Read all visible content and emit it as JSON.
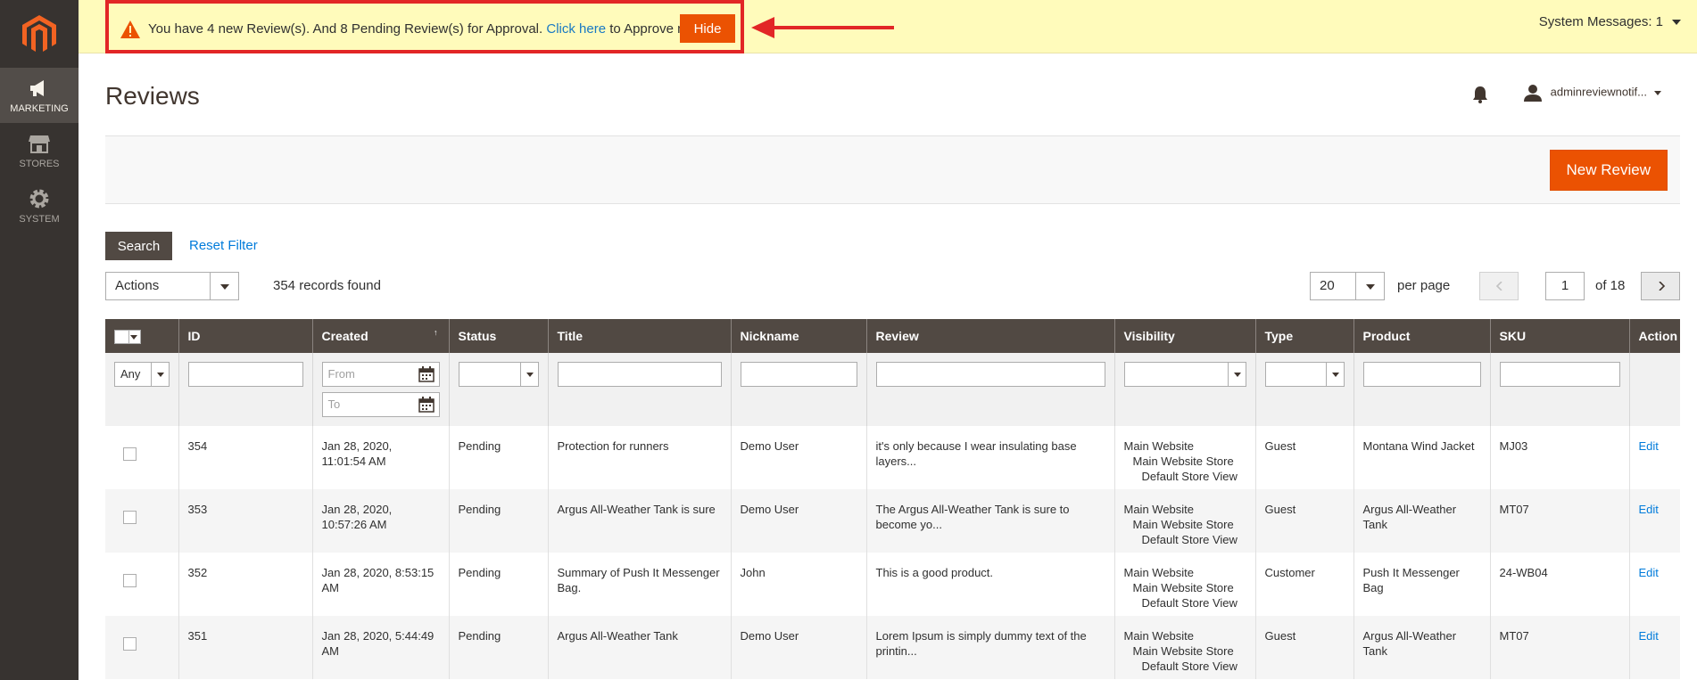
{
  "sidebar": {
    "logo": "magento-logo",
    "items": [
      {
        "label": "MARKETING",
        "icon": "megaphone-icon",
        "active": true
      },
      {
        "label": "STORES",
        "icon": "store-icon",
        "active": false
      },
      {
        "label": "SYSTEM",
        "icon": "gear-icon",
        "active": false
      }
    ]
  },
  "notice": {
    "text_before": "You have 4 new Review(s). And 8 Pending Review(s) for Approval.",
    "link": "Click here",
    "text_after": "to Approve now.",
    "hide_label": "Hide",
    "highlight_color": "#e22626"
  },
  "system_messages": {
    "label": "System Messages: 1"
  },
  "header": {
    "title": "Reviews",
    "user": "adminreviewnotif..."
  },
  "toolbar": {
    "new_review_label": "New Review",
    "search_label": "Search",
    "reset_filter_label": "Reset Filter",
    "actions_label": "Actions",
    "records_found": "354 records found",
    "per_page_value": "20",
    "per_page_label": "per page",
    "page_value": "1",
    "page_of": "of 18"
  },
  "grid": {
    "columns": [
      "ID",
      "Created",
      "Status",
      "Title",
      "Nickname",
      "Review",
      "Visibility",
      "Type",
      "Product",
      "SKU",
      "Action"
    ],
    "filters": {
      "any": "Any",
      "from_placeholder": "From",
      "to_placeholder": "To"
    },
    "rows": [
      {
        "id": "354",
        "created": "Jan 28, 2020, 11:01:54 AM",
        "status": "Pending",
        "title": "Protection for runners",
        "nickname": "Demo User",
        "review": "it's only because I wear insulating base layers...",
        "vis1": "Main Website",
        "vis2": "Main Website Store",
        "vis3": "Default Store View",
        "type": "Guest",
        "product": "Montana Wind Jacket",
        "sku": "MJ03",
        "action": "Edit"
      },
      {
        "id": "353",
        "created": "Jan 28, 2020, 10:57:26 AM",
        "status": "Pending",
        "title": "Argus All-Weather Tank is sure",
        "nickname": "Demo User",
        "review": "The Argus All-Weather Tank is sure to become yo...",
        "vis1": "Main Website",
        "vis2": "Main Website Store",
        "vis3": "Default Store View",
        "type": "Guest",
        "product": "Argus All-Weather Tank",
        "sku": "MT07",
        "action": "Edit"
      },
      {
        "id": "352",
        "created": "Jan 28, 2020, 8:53:15 AM",
        "status": "Pending",
        "title": "Summary of Push It Messenger Bag.",
        "nickname": "John",
        "review": "This is a good product.",
        "vis1": "Main Website",
        "vis2": "Main Website Store",
        "vis3": "Default Store View",
        "type": "Customer",
        "product": "Push It Messenger Bag",
        "sku": "24-WB04",
        "action": "Edit"
      },
      {
        "id": "351",
        "created": "Jan 28, 2020, 5:44:49 AM",
        "status": "Pending",
        "title": "Argus All-Weather Tank",
        "nickname": "Demo User",
        "review": "Lorem Ipsum is simply dummy text of the printin...",
        "vis1": "Main Website",
        "vis2": "Main Website Store",
        "vis3": "Default Store View",
        "type": "Guest",
        "product": "Argus All-Weather Tank",
        "sku": "MT07",
        "action": "Edit"
      }
    ]
  }
}
